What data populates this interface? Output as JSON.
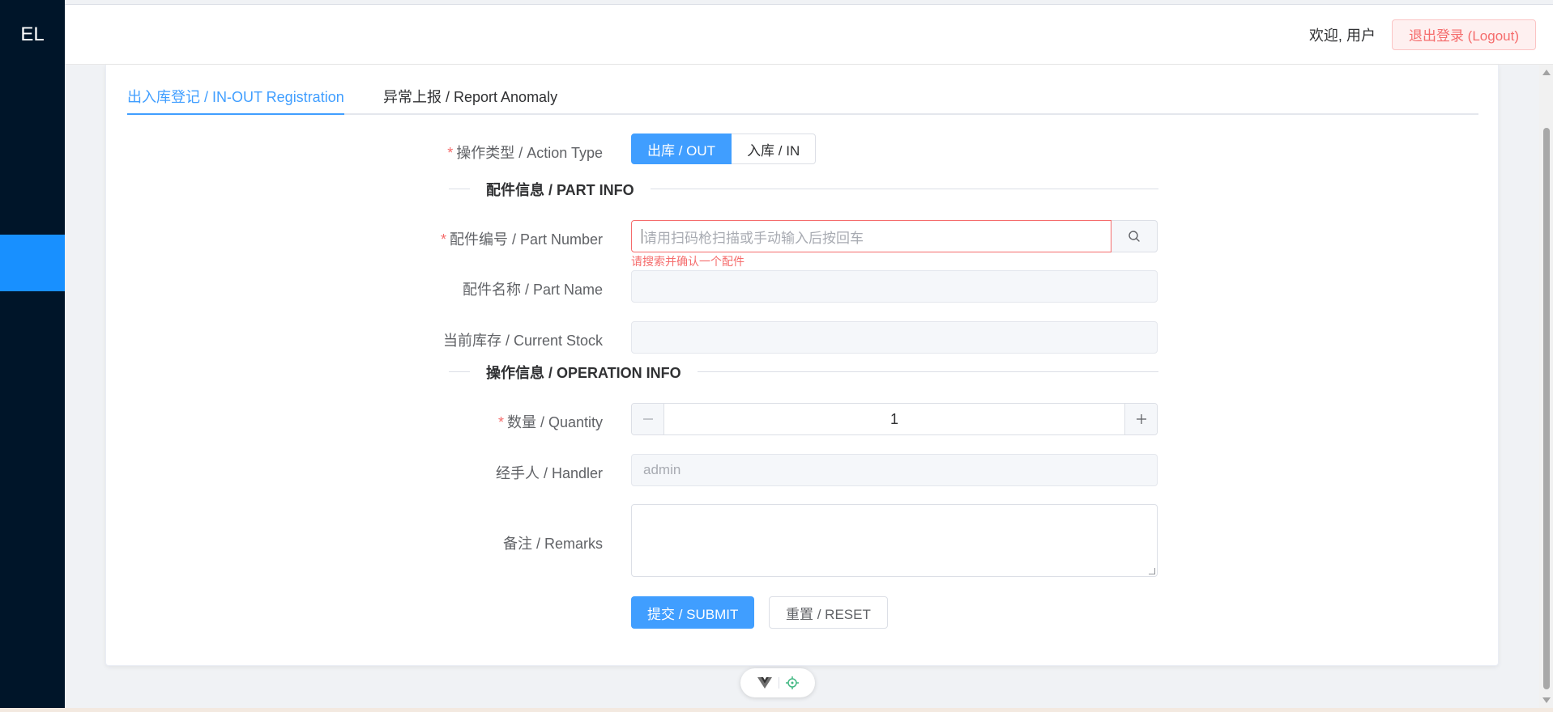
{
  "sidebar": {
    "logo": "EL"
  },
  "header": {
    "welcome": "欢迎, 用户",
    "logout_label": "退出登录 (Logout)"
  },
  "tabs": [
    {
      "label": "出入库登记 / IN-OUT Registration",
      "active": true
    },
    {
      "label": "异常上报 / Report Anomaly",
      "active": false
    }
  ],
  "form": {
    "action_type": {
      "label": "操作类型 / Action Type",
      "options": [
        "出库 / OUT",
        "入库 / IN"
      ],
      "selected": "出库 / OUT"
    },
    "part_info_title": "配件信息 / PART INFO",
    "part_number": {
      "label": "配件编号 / Part Number",
      "placeholder": "请用扫码枪扫描或手动输入后按回车",
      "value": "",
      "error": "请搜索并确认一个配件"
    },
    "part_name": {
      "label": "配件名称 / Part Name",
      "value": ""
    },
    "current_stock": {
      "label": "当前库存 / Current Stock",
      "value": ""
    },
    "operation_info_title": "操作信息 / OPERATION INFO",
    "quantity": {
      "label": "数量 / Quantity",
      "value": "1"
    },
    "handler": {
      "label": "经手人 / Handler",
      "value": "admin"
    },
    "remarks": {
      "label": "备注 / Remarks",
      "value": ""
    },
    "submit_label": "提交 / SUBMIT",
    "reset_label": "重置 / RESET",
    "required_mark": "*"
  },
  "colors": {
    "primary": "#409eff",
    "danger": "#f56c6c",
    "sidebar": "#001529",
    "sidebar_active": "#1890ff"
  },
  "icons": {
    "search": "search-icon",
    "vue_devtools": "vue-logo-icon",
    "inspector": "crosshair-icon"
  }
}
